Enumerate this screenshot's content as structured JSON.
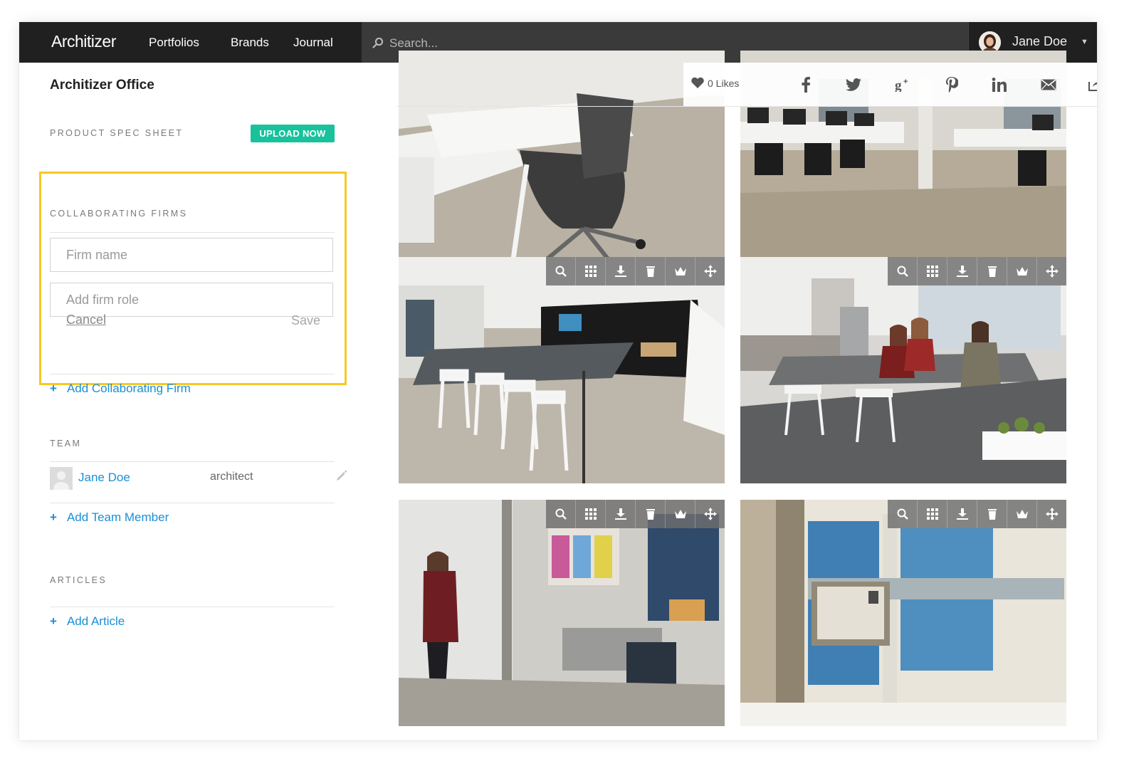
{
  "nav": {
    "logo": "Architizer",
    "links": [
      "Portfolios",
      "Brands",
      "Journal"
    ],
    "search_placeholder": "Search...",
    "user_name": "Jane Doe"
  },
  "header": {
    "title": "Architizer Office",
    "likes_label": "0 Likes",
    "share_icons": [
      "facebook-icon",
      "twitter-icon",
      "google-plus-icon",
      "pinterest-icon",
      "linkedin-icon",
      "email-icon",
      "share-icon"
    ]
  },
  "sidebar": {
    "spec_sheet_label": "PRODUCT SPEC SHEET",
    "upload_label": "UPLOAD NOW",
    "collab_label": "COLLABORATING FIRMS",
    "firm_name_placeholder": "Firm name",
    "firm_role_placeholder": "Add firm role",
    "cancel_label": "Cancel",
    "save_label": "Save",
    "add_firm_label": "Add Collaborating Firm",
    "team_label": "TEAM",
    "team_member_name": "Jane Doe",
    "team_member_role": "architect",
    "add_team_label": "Add Team Member",
    "articles_label": "ARTICLES",
    "add_article_label": "Add Article",
    "plus": "+"
  },
  "gallery": {
    "tool_icons": [
      "zoom-icon",
      "grid-icon",
      "download-icon",
      "trash-icon",
      "crown-icon",
      "move-icon"
    ]
  },
  "colors": {
    "nav_bg": "#202020",
    "accent_green": "#18c29c",
    "link_blue": "#1a8fd6",
    "highlight_yellow": "#f7c823"
  }
}
